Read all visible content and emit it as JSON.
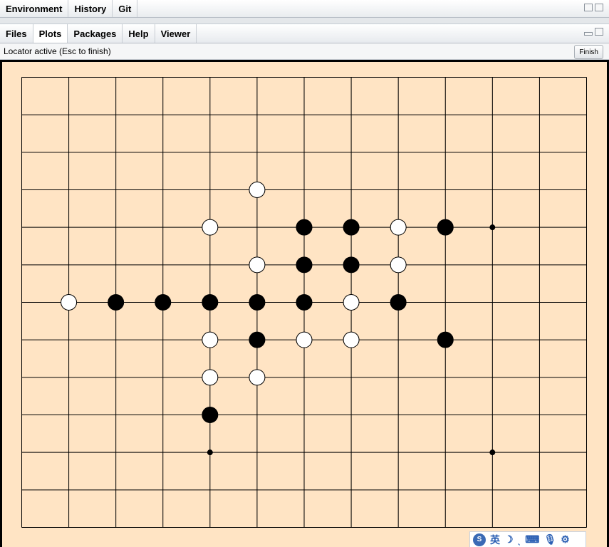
{
  "top_tabs": [
    "Environment",
    "History",
    "Git"
  ],
  "bottom_tabs": [
    "Files",
    "Plots",
    "Packages",
    "Help",
    "Viewer"
  ],
  "active_bottom_tab": "Plots",
  "toolbar": {
    "status": "Locator active (Esc to finish)",
    "finish_label": "Finish"
  },
  "board": {
    "grid_columns": 13,
    "grid_rows": 13,
    "background_color": "#ffe4c4",
    "line_color": "#000000",
    "star_points": [
      [
        10,
        4
      ],
      [
        4,
        10
      ],
      [
        10,
        10
      ]
    ],
    "stones": [
      {
        "col": 5,
        "row": 3,
        "color": "white"
      },
      {
        "col": 4,
        "row": 4,
        "color": "white"
      },
      {
        "col": 6,
        "row": 4,
        "color": "black"
      },
      {
        "col": 7,
        "row": 4,
        "color": "black"
      },
      {
        "col": 8,
        "row": 4,
        "color": "white"
      },
      {
        "col": 9,
        "row": 4,
        "color": "black"
      },
      {
        "col": 5,
        "row": 5,
        "color": "white"
      },
      {
        "col": 6,
        "row": 5,
        "color": "black"
      },
      {
        "col": 7,
        "row": 5,
        "color": "black"
      },
      {
        "col": 8,
        "row": 5,
        "color": "white"
      },
      {
        "col": 1,
        "row": 6,
        "color": "white"
      },
      {
        "col": 2,
        "row": 6,
        "color": "black"
      },
      {
        "col": 3,
        "row": 6,
        "color": "black"
      },
      {
        "col": 4,
        "row": 6,
        "color": "black"
      },
      {
        "col": 5,
        "row": 6,
        "color": "black"
      },
      {
        "col": 6,
        "row": 6,
        "color": "black"
      },
      {
        "col": 7,
        "row": 6,
        "color": "white"
      },
      {
        "col": 8,
        "row": 6,
        "color": "black"
      },
      {
        "col": 4,
        "row": 7,
        "color": "white"
      },
      {
        "col": 5,
        "row": 7,
        "color": "black"
      },
      {
        "col": 6,
        "row": 7,
        "color": "white"
      },
      {
        "col": 7,
        "row": 7,
        "color": "white"
      },
      {
        "col": 9,
        "row": 7,
        "color": "black"
      },
      {
        "col": 4,
        "row": 8,
        "color": "white"
      },
      {
        "col": 5,
        "row": 8,
        "color": "white"
      },
      {
        "col": 4,
        "row": 9,
        "color": "black"
      }
    ]
  },
  "ime_toolbar": {
    "logo": "S",
    "language": "英",
    "items": [
      "moon-icon",
      "punctuation-icon",
      "keyboard-icon",
      "microphone-icon",
      "gear-icon"
    ]
  }
}
